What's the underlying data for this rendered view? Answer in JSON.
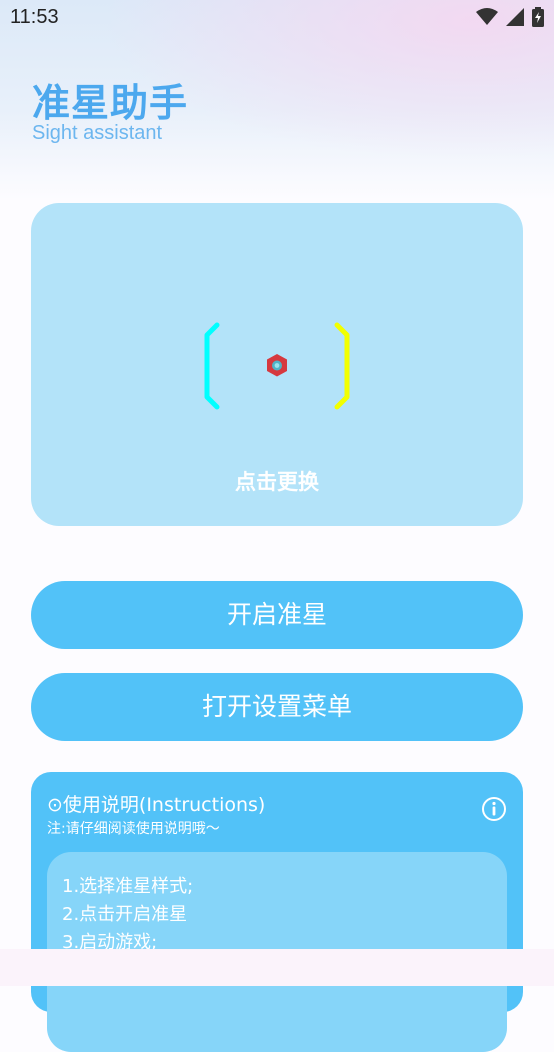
{
  "status_bar": {
    "time": "11:53",
    "icons": [
      "wifi-icon",
      "signal-icon",
      "battery-icon"
    ]
  },
  "header": {
    "title": "准星助手",
    "subtitle": "Sight assistant"
  },
  "preview": {
    "hint": "点击更换",
    "colors": {
      "left_bracket": "#00ffff",
      "right_bracket": "#f2ff00",
      "center": "#d6393f"
    }
  },
  "buttons": {
    "enable_sight": "开启准星",
    "open_settings": "打开设置菜单"
  },
  "instructions": {
    "title": "⊙使用说明(Instructions)",
    "note": "注:请仔细阅读使用说明哦～",
    "steps": [
      "1.选择准星样式;",
      "2.点击开启准星",
      "3.启动游戏;"
    ]
  },
  "colors": {
    "accent": "#52c2f8",
    "title": "#4ca8ee",
    "card": "#b3e3f9"
  }
}
